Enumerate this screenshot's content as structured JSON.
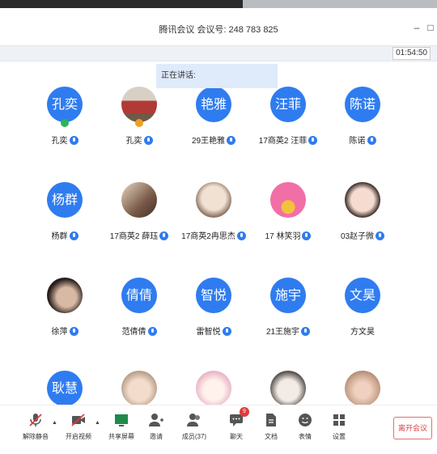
{
  "window": {
    "title": "腾讯会议 会议号: 248 783 825",
    "timer": "01:54:50",
    "speaking_label": "正在讲话:"
  },
  "participants": [
    {
      "avatar_text": "孔奕",
      "name": "孔奕",
      "avatar_kind": "text",
      "badge": "green"
    },
    {
      "avatar_text": "",
      "name": "孔奕",
      "avatar_kind": "photo",
      "badge": "orange"
    },
    {
      "avatar_text": "艳雅",
      "name": "29王艳雅",
      "avatar_kind": "text"
    },
    {
      "avatar_text": "汪菲",
      "name": "17商英2 汪菲",
      "avatar_kind": "text"
    },
    {
      "avatar_text": "陈诺",
      "name": "陈诺",
      "avatar_kind": "text"
    },
    {
      "avatar_text": "杨群",
      "name": "杨群",
      "avatar_kind": "text"
    },
    {
      "avatar_text": "",
      "name": "17商英2 薛珏",
      "avatar_kind": "photo"
    },
    {
      "avatar_text": "",
      "name": "17商英2冉思杰",
      "avatar_kind": "photo"
    },
    {
      "avatar_text": "",
      "name": "17 林笑羽",
      "avatar_kind": "photo"
    },
    {
      "avatar_text": "",
      "name": "03赵子微",
      "avatar_kind": "photo"
    },
    {
      "avatar_text": "",
      "name": "徐萍",
      "avatar_kind": "photo"
    },
    {
      "avatar_text": "倩倩",
      "name": "范倩倩",
      "avatar_kind": "text"
    },
    {
      "avatar_text": "智悦",
      "name": "雷智悦",
      "avatar_kind": "text"
    },
    {
      "avatar_text": "施宇",
      "name": "21王施宇",
      "avatar_kind": "text"
    },
    {
      "avatar_text": "文昊",
      "name": "方文昊",
      "avatar_kind": "text",
      "no_mic": true
    },
    {
      "avatar_text": "耿慧",
      "name": "",
      "avatar_kind": "text"
    },
    {
      "avatar_text": "",
      "name": "",
      "avatar_kind": "photo"
    },
    {
      "avatar_text": "",
      "name": "",
      "avatar_kind": "photo"
    },
    {
      "avatar_text": "",
      "name": "",
      "avatar_kind": "photo"
    },
    {
      "avatar_text": "",
      "name": "",
      "avatar_kind": "photo"
    }
  ],
  "toolbar": {
    "unmute": "解除静音",
    "start_video": "开启视频",
    "share_screen": "共享屏幕",
    "invite": "邀请",
    "members": "成员(37)",
    "chat": "聊天",
    "chat_badge": "9",
    "docs": "文档",
    "emoji": "表情",
    "settings": "设置",
    "leave": "离开会议"
  },
  "colors": {
    "accent": "#2f7cf0",
    "leave": "#d94444"
  }
}
